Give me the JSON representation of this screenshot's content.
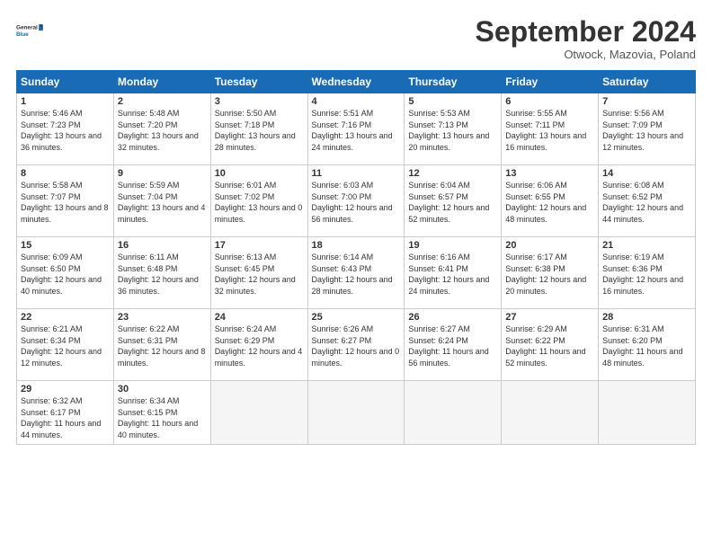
{
  "header": {
    "logo_line1": "General",
    "logo_line2": "Blue",
    "month": "September 2024",
    "location": "Otwock, Mazovia, Poland"
  },
  "weekdays": [
    "Sunday",
    "Monday",
    "Tuesday",
    "Wednesday",
    "Thursday",
    "Friday",
    "Saturday"
  ],
  "weeks": [
    [
      {
        "day": "1",
        "sunrise": "Sunrise: 5:46 AM",
        "sunset": "Sunset: 7:23 PM",
        "daylight": "Daylight: 13 hours and 36 minutes."
      },
      {
        "day": "2",
        "sunrise": "Sunrise: 5:48 AM",
        "sunset": "Sunset: 7:20 PM",
        "daylight": "Daylight: 13 hours and 32 minutes."
      },
      {
        "day": "3",
        "sunrise": "Sunrise: 5:50 AM",
        "sunset": "Sunset: 7:18 PM",
        "daylight": "Daylight: 13 hours and 28 minutes."
      },
      {
        "day": "4",
        "sunrise": "Sunrise: 5:51 AM",
        "sunset": "Sunset: 7:16 PM",
        "daylight": "Daylight: 13 hours and 24 minutes."
      },
      {
        "day": "5",
        "sunrise": "Sunrise: 5:53 AM",
        "sunset": "Sunset: 7:13 PM",
        "daylight": "Daylight: 13 hours and 20 minutes."
      },
      {
        "day": "6",
        "sunrise": "Sunrise: 5:55 AM",
        "sunset": "Sunset: 7:11 PM",
        "daylight": "Daylight: 13 hours and 16 minutes."
      },
      {
        "day": "7",
        "sunrise": "Sunrise: 5:56 AM",
        "sunset": "Sunset: 7:09 PM",
        "daylight": "Daylight: 13 hours and 12 minutes."
      }
    ],
    [
      {
        "day": "8",
        "sunrise": "Sunrise: 5:58 AM",
        "sunset": "Sunset: 7:07 PM",
        "daylight": "Daylight: 13 hours and 8 minutes."
      },
      {
        "day": "9",
        "sunrise": "Sunrise: 5:59 AM",
        "sunset": "Sunset: 7:04 PM",
        "daylight": "Daylight: 13 hours and 4 minutes."
      },
      {
        "day": "10",
        "sunrise": "Sunrise: 6:01 AM",
        "sunset": "Sunset: 7:02 PM",
        "daylight": "Daylight: 13 hours and 0 minutes."
      },
      {
        "day": "11",
        "sunrise": "Sunrise: 6:03 AM",
        "sunset": "Sunset: 7:00 PM",
        "daylight": "Daylight: 12 hours and 56 minutes."
      },
      {
        "day": "12",
        "sunrise": "Sunrise: 6:04 AM",
        "sunset": "Sunset: 6:57 PM",
        "daylight": "Daylight: 12 hours and 52 minutes."
      },
      {
        "day": "13",
        "sunrise": "Sunrise: 6:06 AM",
        "sunset": "Sunset: 6:55 PM",
        "daylight": "Daylight: 12 hours and 48 minutes."
      },
      {
        "day": "14",
        "sunrise": "Sunrise: 6:08 AM",
        "sunset": "Sunset: 6:52 PM",
        "daylight": "Daylight: 12 hours and 44 minutes."
      }
    ],
    [
      {
        "day": "15",
        "sunrise": "Sunrise: 6:09 AM",
        "sunset": "Sunset: 6:50 PM",
        "daylight": "Daylight: 12 hours and 40 minutes."
      },
      {
        "day": "16",
        "sunrise": "Sunrise: 6:11 AM",
        "sunset": "Sunset: 6:48 PM",
        "daylight": "Daylight: 12 hours and 36 minutes."
      },
      {
        "day": "17",
        "sunrise": "Sunrise: 6:13 AM",
        "sunset": "Sunset: 6:45 PM",
        "daylight": "Daylight: 12 hours and 32 minutes."
      },
      {
        "day": "18",
        "sunrise": "Sunrise: 6:14 AM",
        "sunset": "Sunset: 6:43 PM",
        "daylight": "Daylight: 12 hours and 28 minutes."
      },
      {
        "day": "19",
        "sunrise": "Sunrise: 6:16 AM",
        "sunset": "Sunset: 6:41 PM",
        "daylight": "Daylight: 12 hours and 24 minutes."
      },
      {
        "day": "20",
        "sunrise": "Sunrise: 6:17 AM",
        "sunset": "Sunset: 6:38 PM",
        "daylight": "Daylight: 12 hours and 20 minutes."
      },
      {
        "day": "21",
        "sunrise": "Sunrise: 6:19 AM",
        "sunset": "Sunset: 6:36 PM",
        "daylight": "Daylight: 12 hours and 16 minutes."
      }
    ],
    [
      {
        "day": "22",
        "sunrise": "Sunrise: 6:21 AM",
        "sunset": "Sunset: 6:34 PM",
        "daylight": "Daylight: 12 hours and 12 minutes."
      },
      {
        "day": "23",
        "sunrise": "Sunrise: 6:22 AM",
        "sunset": "Sunset: 6:31 PM",
        "daylight": "Daylight: 12 hours and 8 minutes."
      },
      {
        "day": "24",
        "sunrise": "Sunrise: 6:24 AM",
        "sunset": "Sunset: 6:29 PM",
        "daylight": "Daylight: 12 hours and 4 minutes."
      },
      {
        "day": "25",
        "sunrise": "Sunrise: 6:26 AM",
        "sunset": "Sunset: 6:27 PM",
        "daylight": "Daylight: 12 hours and 0 minutes."
      },
      {
        "day": "26",
        "sunrise": "Sunrise: 6:27 AM",
        "sunset": "Sunset: 6:24 PM",
        "daylight": "Daylight: 11 hours and 56 minutes."
      },
      {
        "day": "27",
        "sunrise": "Sunrise: 6:29 AM",
        "sunset": "Sunset: 6:22 PM",
        "daylight": "Daylight: 11 hours and 52 minutes."
      },
      {
        "day": "28",
        "sunrise": "Sunrise: 6:31 AM",
        "sunset": "Sunset: 6:20 PM",
        "daylight": "Daylight: 11 hours and 48 minutes."
      }
    ],
    [
      {
        "day": "29",
        "sunrise": "Sunrise: 6:32 AM",
        "sunset": "Sunset: 6:17 PM",
        "daylight": "Daylight: 11 hours and 44 minutes."
      },
      {
        "day": "30",
        "sunrise": "Sunrise: 6:34 AM",
        "sunset": "Sunset: 6:15 PM",
        "daylight": "Daylight: 11 hours and 40 minutes."
      },
      {
        "day": "",
        "sunrise": "",
        "sunset": "",
        "daylight": ""
      },
      {
        "day": "",
        "sunrise": "",
        "sunset": "",
        "daylight": ""
      },
      {
        "day": "",
        "sunrise": "",
        "sunset": "",
        "daylight": ""
      },
      {
        "day": "",
        "sunrise": "",
        "sunset": "",
        "daylight": ""
      },
      {
        "day": "",
        "sunrise": "",
        "sunset": "",
        "daylight": ""
      }
    ]
  ]
}
